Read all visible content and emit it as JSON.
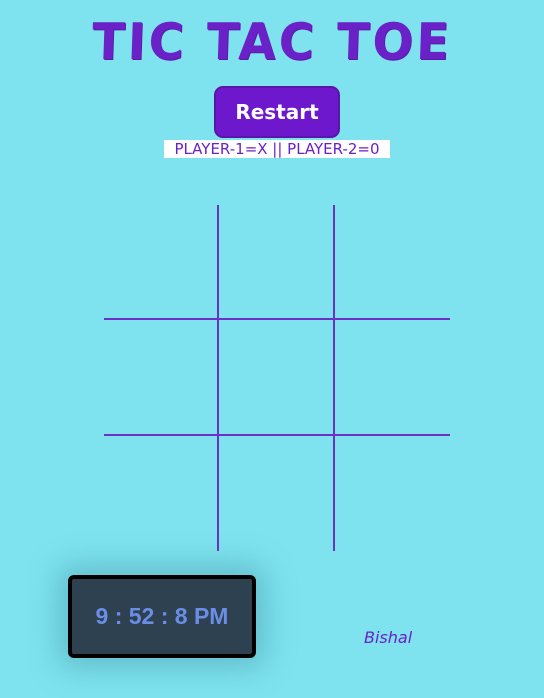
{
  "header": {
    "title": "TIC TAC TOE",
    "restart_label": "Restart",
    "players_label": "PLAYER-1=X || PLAYER-2=0"
  },
  "board": {
    "cells": [
      "",
      "",
      "",
      "",
      "",
      "",
      "",
      "",
      ""
    ]
  },
  "clock": {
    "time": "9 : 52 : 8 PM"
  },
  "footer": {
    "author": "Bishal"
  },
  "colors": {
    "background": "#7ee3ef",
    "accent": "#6b21c8",
    "clock_bg": "#2e4150",
    "clock_text": "#6a8ee6"
  }
}
